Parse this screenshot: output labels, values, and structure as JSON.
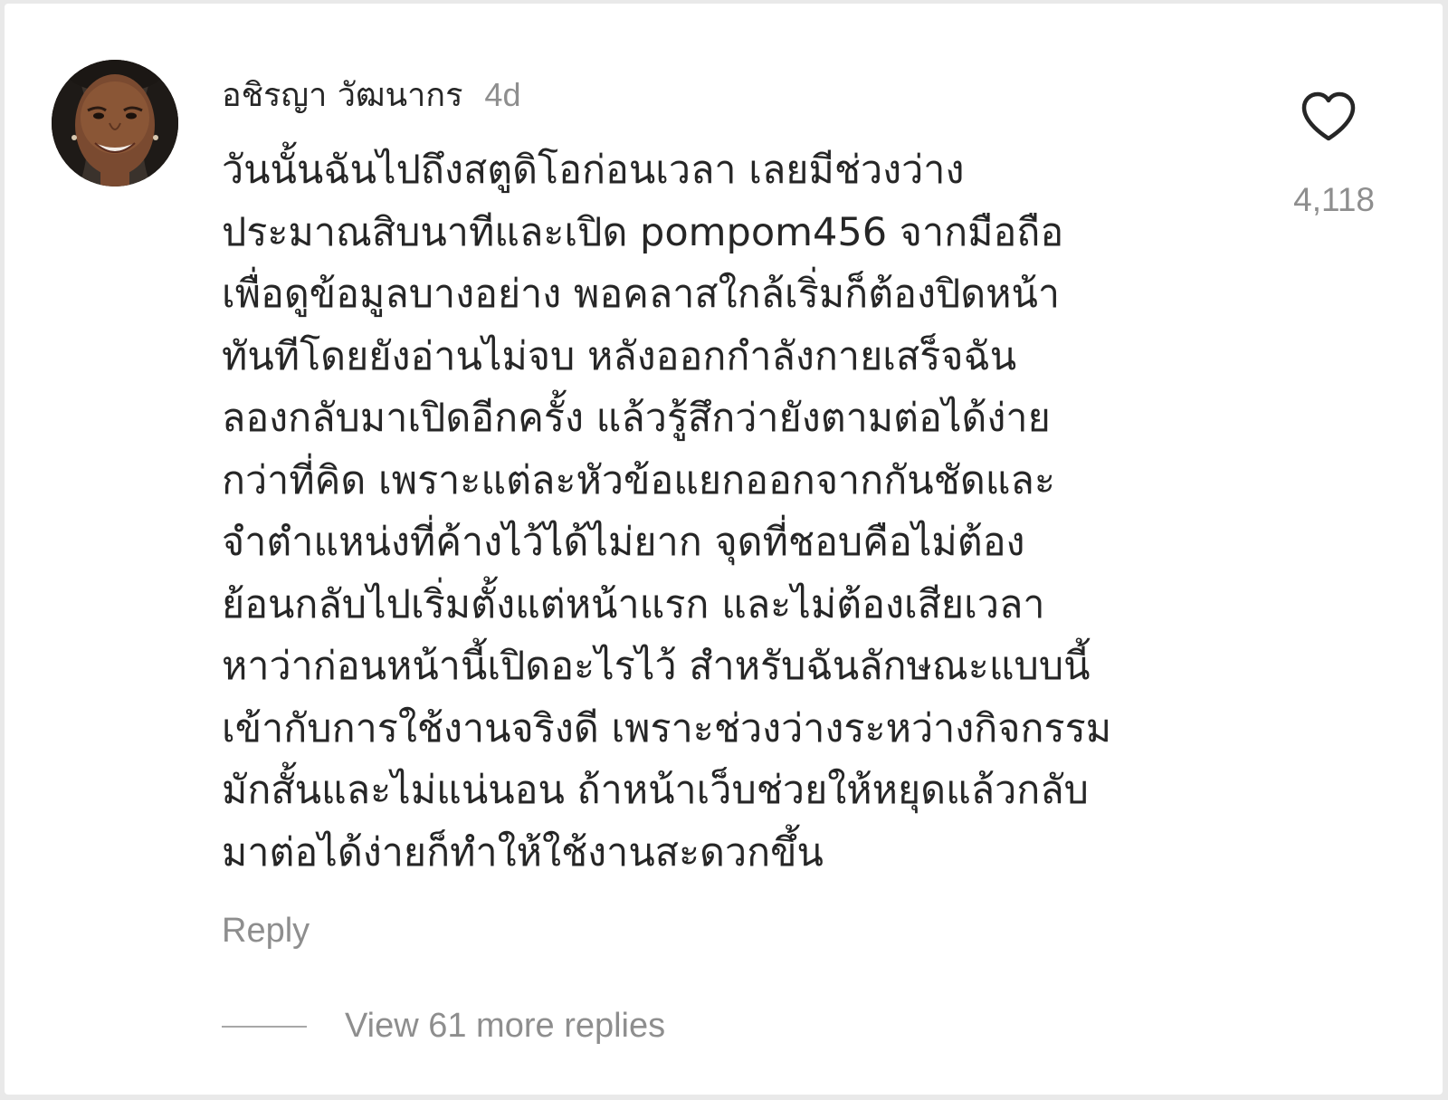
{
  "comment": {
    "username": "อชิรญา วัฒนากร",
    "timestamp": "4d",
    "text": "วันนั้นฉันไปถึงสตูดิโอก่อนเวลา เลยมีช่วงว่าง\nประมาณสิบนาทีและเปิด pompom456 จากมือถือ\nเพื่อดูข้อมูลบางอย่าง พอคลาสใกล้เริ่มก็ต้องปิดหน้า\nทันทีโดยยังอ่านไม่จบ หลังออกกำลังกายเสร็จฉัน\nลองกลับมาเปิดอีกครั้ง แล้วรู้สึกว่ายังตามต่อได้ง่าย\nกว่าที่คิด เพราะแต่ละหัวข้อแยกออกจากกันชัดและ\nจำตำแหน่งที่ค้างไว้ได้ไม่ยาก จุดที่ชอบคือไม่ต้อง\nย้อนกลับไปเริ่มตั้งแต่หน้าแรก และไม่ต้องเสียเวลา\nหาว่าก่อนหน้านี้เปิดอะไรไว้ สำหรับฉันลักษณะแบบนี้\nเข้ากับการใช้งานจริงดี เพราะช่วงว่างระหว่างกิจกรรม\nมักสั้นและไม่แน่นอน ถ้าหน้าเว็บช่วยให้หยุดแล้วกลับ\nมาต่อได้ง่ายก็ทำให้ใช้งานสะดวกขึ้น",
    "reply_label": "Reply",
    "view_replies_label": "View 61 more replies",
    "like_count": "4,118",
    "like_icon": "heart-outline-icon",
    "avatar_icon": "user-avatar"
  }
}
